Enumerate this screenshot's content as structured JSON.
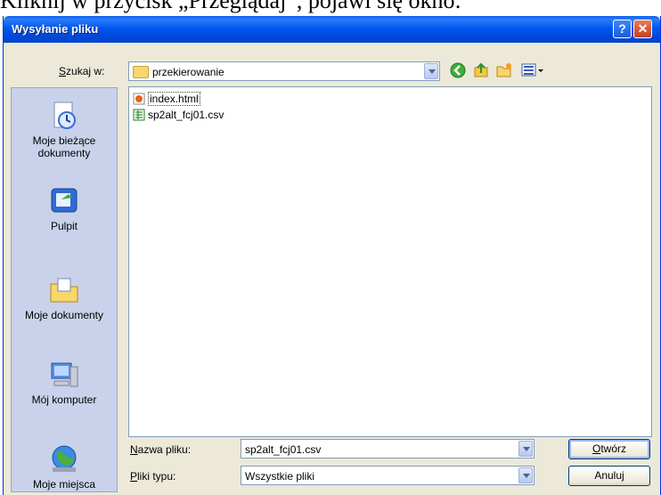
{
  "page_text": "Kliknij w przycisk „Przeglądaj”, pojawi się okno:",
  "window": {
    "title": "Wysyłanie pliku",
    "help_button": "?",
    "close_button": "✕"
  },
  "lookin": {
    "label_u": "S",
    "label_rest": "zukaj w:",
    "value": "przekierowanie"
  },
  "toolbar": {
    "icons": [
      "back-icon",
      "up-folder-icon",
      "new-folder-icon",
      "views-menu-icon"
    ]
  },
  "places": [
    {
      "label": "Moje bieżące dokumenty",
      "icon": "recent-documents-icon"
    },
    {
      "label": "Pulpit",
      "icon": "desktop-icon"
    },
    {
      "label": "Moje dokumenty",
      "icon": "my-documents-icon"
    },
    {
      "label": "Mój komputer",
      "icon": "my-computer-icon"
    },
    {
      "label": "Moje miejsca",
      "icon": "network-places-icon"
    }
  ],
  "files": [
    {
      "name": "index.html",
      "icon": "html-file-icon"
    },
    {
      "name": "sp2alt_fcj01.csv",
      "icon": "csv-file-icon"
    }
  ],
  "filename": {
    "label_u": "N",
    "label_rest": "azwa pliku:",
    "value": "sp2alt_fcj01.csv"
  },
  "filetype": {
    "label_u": "P",
    "label_rest": "liki typu:",
    "value": "Wszystkie pliki"
  },
  "buttons": {
    "open_u": "O",
    "open_rest": "twórz",
    "cancel": "Anuluj"
  }
}
